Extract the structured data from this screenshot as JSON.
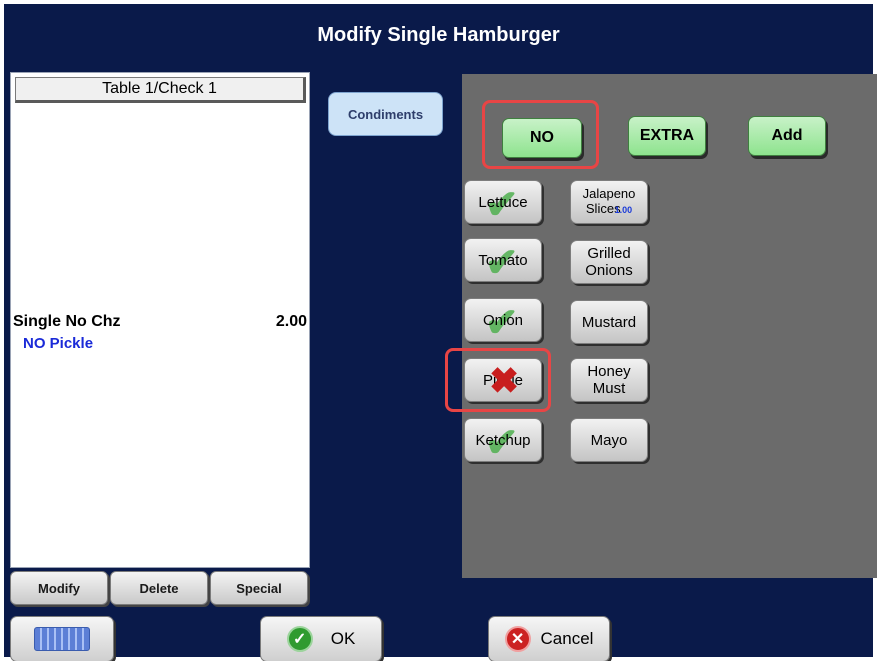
{
  "window": {
    "title": "Modify Single Hamburger"
  },
  "check": {
    "header": "Table 1/Check 1",
    "item_name": "Single  No Chz",
    "item_price": "2.00",
    "modifier": "NO Pickle"
  },
  "actions": {
    "modify": "Modify",
    "delete": "Delete",
    "special": "Special"
  },
  "bottom": {
    "ok": "OK",
    "cancel": "Cancel"
  },
  "category": {
    "label": "Condiments"
  },
  "modes": {
    "no": "NO",
    "extra": "EXTRA",
    "add": "Add"
  },
  "condiments": {
    "lettuce": "Lettuce",
    "tomato": "Tomato",
    "onion": "Onion",
    "pickle": "Pickle",
    "ketchup": "Ketchup",
    "jalapeno_line1": "Jalapeno",
    "jalapeno_line2": "Slices",
    "jalapeno_price": "1.00",
    "grilled_onions_line1": "Grilled",
    "grilled_onions_line2": "Onions",
    "mustard": "Mustard",
    "honey_must_line1": "Honey",
    "honey_must_line2": "Must",
    "mayo": "Mayo"
  },
  "colors": {
    "background": "#0a1a4a",
    "panel": "#6b6b6b",
    "mode_button": "#8ee38e",
    "highlight": "#e84545",
    "modifier_text": "#1a2ad8"
  },
  "icons": {
    "keyboard": "keyboard-icon",
    "ok": "checkmark-icon",
    "cancel": "x-circle-icon",
    "selected": "checkmark-icon",
    "removed": "x-icon"
  }
}
